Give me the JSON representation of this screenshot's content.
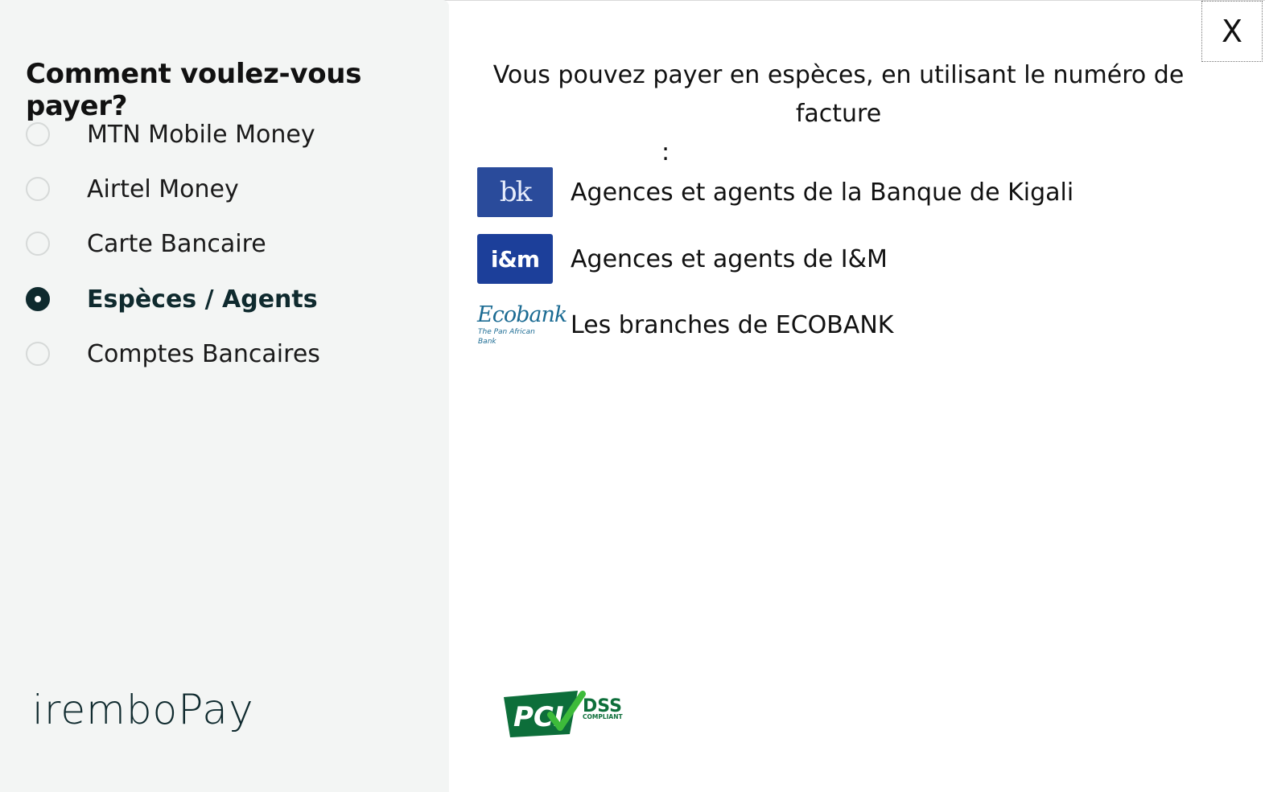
{
  "dialog": {
    "close_label": "X"
  },
  "sidebar": {
    "title": "Comment voulez-vous payer?",
    "methods": [
      {
        "label": "MTN Mobile Money",
        "selected": false
      },
      {
        "label": "Airtel Money",
        "selected": false
      },
      {
        "label": "Carte Bancaire",
        "selected": false
      },
      {
        "label": "Espèces / Agents",
        "selected": true
      },
      {
        "label": "Comptes Bancaires",
        "selected": false
      }
    ],
    "brand": {
      "part1": "irembo",
      "part2": "Pay"
    }
  },
  "main": {
    "intro_line1": "Vous pouvez payer en espèces, en utilisant le numéro de facture",
    "intro_line2": ":",
    "providers": [
      {
        "logo": "bank-of-kigali-logo",
        "logo_text": "bk",
        "name": "Agences et agents de la Banque de Kigali"
      },
      {
        "logo": "im-bank-logo",
        "logo_text": "i&m",
        "name": "Agences et agents de I&M"
      },
      {
        "logo": "ecobank-logo",
        "logo_text": "Ecobank",
        "logo_subtext": "The Pan African Bank",
        "name": "Les branches de ECOBANK"
      }
    ],
    "pci_badge": {
      "main": "PCI",
      "dss": "DSS",
      "compliant": "COMPLIANT"
    }
  },
  "colors": {
    "sidebar_bg": "#f3f5f4",
    "brand_dark": "#0f2a2e",
    "bk_blue": "#2a4b9b",
    "im_blue": "#1c3f9a",
    "ecobank_blue": "#1b6b93",
    "pci_green": "#0d6e3a",
    "check_green": "#3dbb3a"
  }
}
